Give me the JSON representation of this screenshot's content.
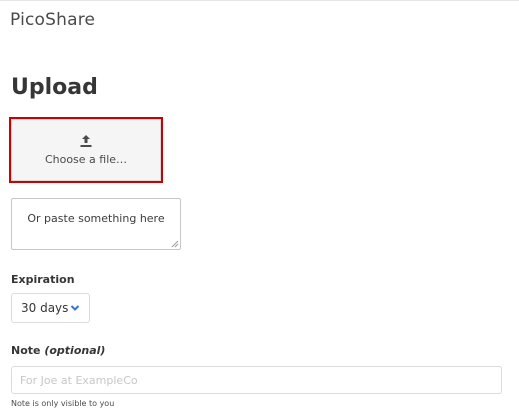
{
  "app": {
    "brand": "PicoShare"
  },
  "upload": {
    "title": "Upload",
    "choose_label": "Choose a file…",
    "paste_placeholder": "Or paste something here"
  },
  "expiration": {
    "label": "Expiration",
    "selected": "30 days"
  },
  "note": {
    "label": "Note",
    "optional_label": "(optional)",
    "placeholder": "For Joe at ExampleCo",
    "help": "Note is only visible to you"
  },
  "colors": {
    "highlight": "#cc0000",
    "chevron": "#3273dc"
  },
  "icons": {
    "upload": "upload-icon",
    "dropdown": "chevron-down-icon",
    "resize": "resize-handle-icon"
  }
}
